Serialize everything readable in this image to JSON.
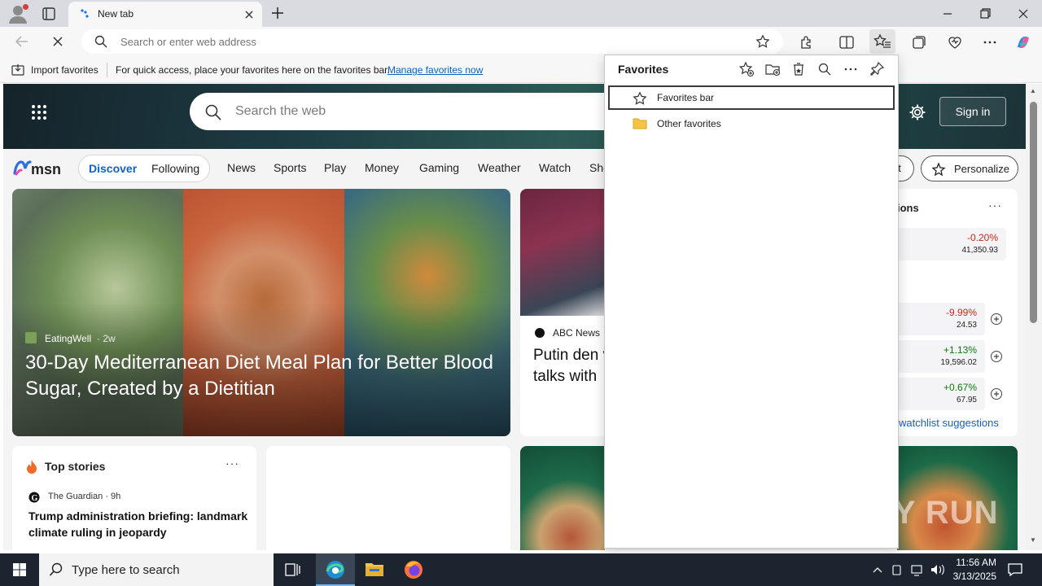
{
  "browser": {
    "tab": {
      "title": "New tab"
    },
    "omnibox": {
      "placeholder": "Search or enter web address"
    },
    "favorites_bar": {
      "import_label": "Import favorites",
      "message": "For quick access, place your favorites here on the favorites bar.",
      "manage_link": "Manage favorites now"
    }
  },
  "favorites_panel": {
    "title": "Favorites",
    "items": [
      {
        "label": "Favorites bar",
        "icon": "star-icon"
      },
      {
        "label": "Other favorites",
        "icon": "folder-icon"
      }
    ]
  },
  "msn": {
    "search_placeholder": "Search the web",
    "sign_in": "Sign in",
    "logo_text": "msn",
    "tabs": {
      "discover": "Discover",
      "following": "Following"
    },
    "nav": [
      "News",
      "Sports",
      "Play",
      "Money",
      "Gaming",
      "Weather",
      "Watch",
      "Sho"
    ],
    "layout_fragment": "ut",
    "personalize": "Personalize",
    "hero": {
      "source": "EatingWell",
      "time": "· 2w",
      "title": "30-Day Mediterranean Diet Meal Plan for Better Blood Sugar, Created by a Dietitian"
    },
    "card2": {
      "source": "ABC News",
      "title": "Putin den victory ah talks with"
    },
    "watchlist": {
      "title_fragment": "ions",
      "more": "···",
      "rows": [
        {
          "pct": "-0.20%",
          "value": "41,350.93",
          "color": "#c42b1c",
          "plus": false
        },
        {
          "pct": "-9.99%",
          "value": "24.53",
          "color": "#c42b1c",
          "plus": true
        },
        {
          "pct": "+1.13%",
          "value": "19,596.02",
          "color": "#0f7b0f",
          "plus": true
        },
        {
          "pct": "+0.67%",
          "value": "67.95",
          "color": "#0f7b0f",
          "plus": true
        }
      ],
      "suggestions_link": "watchlist suggestions"
    },
    "top_stories": {
      "title": "Top stories",
      "more": "···",
      "source": "The Guardian · 9h",
      "headline": "Trump administration briefing: landmark climate ruling in jeopardy"
    },
    "watermark": "ANY RUN"
  },
  "taskbar": {
    "search_placeholder": "Type here to search",
    "time": "11:56 AM",
    "date": "3/13/2025"
  },
  "colors": {
    "accent": "#0f62c8",
    "taskbar": "#1c2430"
  }
}
